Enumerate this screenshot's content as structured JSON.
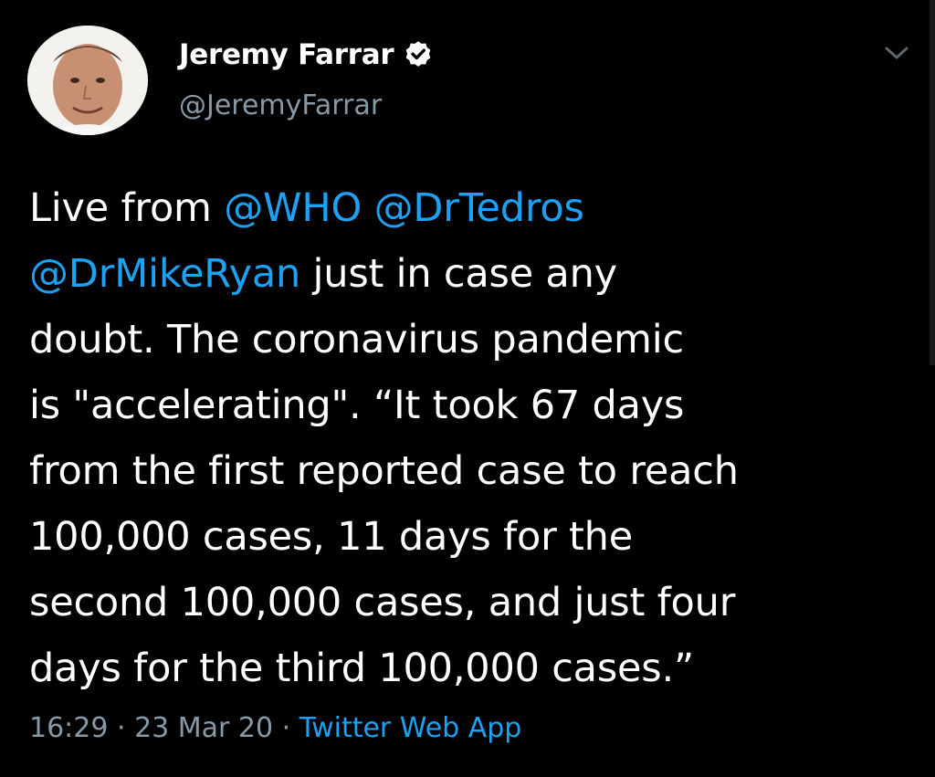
{
  "author": {
    "display_name": "Jeremy Farrar",
    "handle": "@JeremyFarrar"
  },
  "tweet": {
    "lines": [
      [
        {
          "text": "Live from ",
          "type": "text"
        },
        {
          "text": "@WHO",
          "type": "mention"
        },
        {
          "text": " ",
          "type": "text"
        },
        {
          "text": "@DrTedros",
          "type": "mention"
        }
      ],
      [
        {
          "text": "@DrMikeRyan",
          "type": "mention"
        },
        {
          "text": " just in case any",
          "type": "text"
        }
      ],
      [
        {
          "text": "doubt. The coronavirus pandemic",
          "type": "text"
        }
      ],
      [
        {
          "text": "is \"accelerating\".  “It took 67 days",
          "type": "text"
        }
      ],
      [
        {
          "text": "from the first reported case to reach",
          "type": "text"
        }
      ],
      [
        {
          "text": "100,000 cases, 11 days for the",
          "type": "text"
        }
      ],
      [
        {
          "text": "second 100,000 cases, and just four",
          "type": "text"
        }
      ],
      [
        {
          "text": "days for the third 100,000 cases.”",
          "type": "text"
        }
      ]
    ]
  },
  "meta": {
    "time": "16:29",
    "separator": " · ",
    "date": "23 Mar 20",
    "source": "Twitter Web App"
  },
  "icons": {
    "verified": "verified-badge-icon",
    "menu": "chevron-down-icon"
  },
  "colors": {
    "background": "#000000",
    "text": "#ffffff",
    "secondary": "#8899a6",
    "link": "#1da1f2"
  }
}
